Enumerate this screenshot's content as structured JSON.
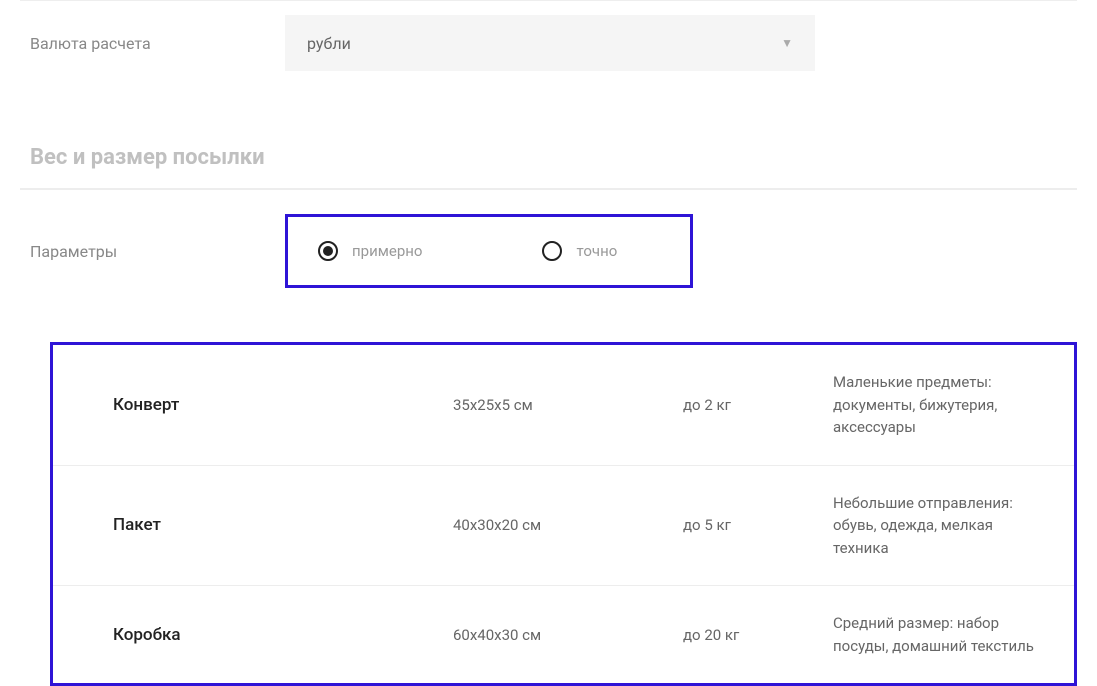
{
  "currency": {
    "label": "Валюта расчета",
    "selected": "рубли"
  },
  "section_title": "Вес и размер посылки",
  "params": {
    "label": "Параметры",
    "options": [
      {
        "label": "примерно",
        "selected": true
      },
      {
        "label": "точно",
        "selected": false
      }
    ]
  },
  "package_types": [
    {
      "name": "Конверт",
      "size": "35x25x5 см",
      "weight": "до 2 кг",
      "desc": "Маленькие предметы: документы, бижутерия, аксессуары"
    },
    {
      "name": "Пакет",
      "size": "40x30x20 см",
      "weight": "до 5 кг",
      "desc": "Небольшие отправления: обувь, одежда, мелкая техника"
    },
    {
      "name": "Коробка",
      "size": "60x40x30 см",
      "weight": "до 20 кг",
      "desc": "Средний размер: набор посуды, домашний текстиль"
    }
  ]
}
